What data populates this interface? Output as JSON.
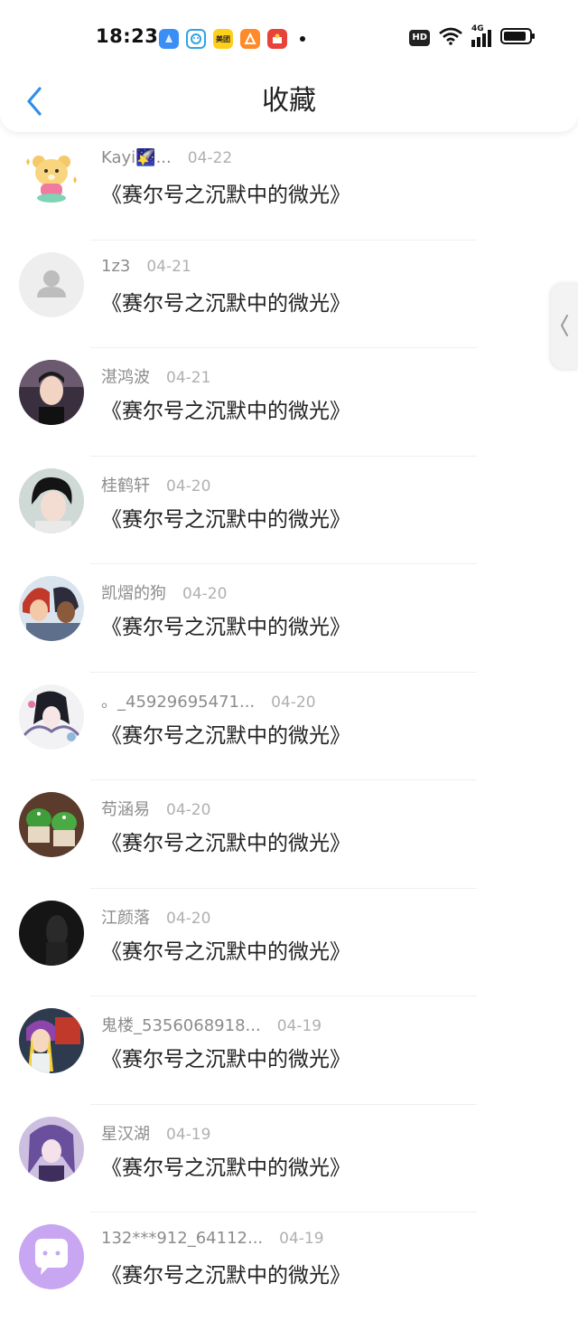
{
  "status_bar": {
    "time": "18:23",
    "hd_badge": "HD",
    "network": "4G",
    "apps": [
      {
        "name": "browser-app-icon",
        "color": "#3a8ef6",
        "label": ""
      },
      {
        "name": "assistant-app-icon",
        "color": "#2fa3e6",
        "label": ""
      },
      {
        "name": "meituan-app-icon",
        "color": "#ffcf1a",
        "label": "美团"
      },
      {
        "name": "orange-app-icon",
        "color": "#ff8a2a",
        "label": ""
      },
      {
        "name": "news-app-icon",
        "color": "#e8433b",
        "label": ""
      }
    ]
  },
  "header": {
    "title": "收藏",
    "accent_color": "#2f8fe8"
  },
  "items": [
    {
      "name": "Kayi🌠...",
      "date": "04-22",
      "title": "《赛尔号之沉默中的微光》",
      "avatar": "cartoon-bear-avatar"
    },
    {
      "name": "1z3",
      "date": "04-21",
      "title": "《赛尔号之沉默中的微光》",
      "avatar": "default-person-avatar"
    },
    {
      "name": "湛鸿波",
      "date": "04-21",
      "title": "《赛尔号之沉默中的微光》",
      "avatar": "photo-avatar"
    },
    {
      "name": "桂鹤轩",
      "date": "04-20",
      "title": "《赛尔号之沉默中的微光》",
      "avatar": "photo-avatar"
    },
    {
      "name": "凯熠的狗",
      "date": "04-20",
      "title": "《赛尔号之沉默中的微光》",
      "avatar": "anime-avatar"
    },
    {
      "name": "。_45929695471...",
      "date": "04-20",
      "title": "《赛尔号之沉默中的微光》",
      "avatar": "anime-avatar"
    },
    {
      "name": "苟涵易",
      "date": "04-20",
      "title": "《赛尔号之沉默中的微光》",
      "avatar": "cake-photo-avatar"
    },
    {
      "name": "江颜落",
      "date": "04-20",
      "title": "《赛尔号之沉默中的微光》",
      "avatar": "dark-photo-avatar"
    },
    {
      "name": "鬼楼_5356068918...",
      "date": "04-19",
      "title": "《赛尔号之沉默中的微光》",
      "avatar": "anime-avatar"
    },
    {
      "name": "星汉湖",
      "date": "04-19",
      "title": "《赛尔号之沉默中的微光》",
      "avatar": "anime-avatar"
    },
    {
      "name": "132***912_64112...",
      "date": "04-19",
      "title": "《赛尔号之沉默中的微光》",
      "avatar": "chat-bubble-avatar"
    }
  ]
}
